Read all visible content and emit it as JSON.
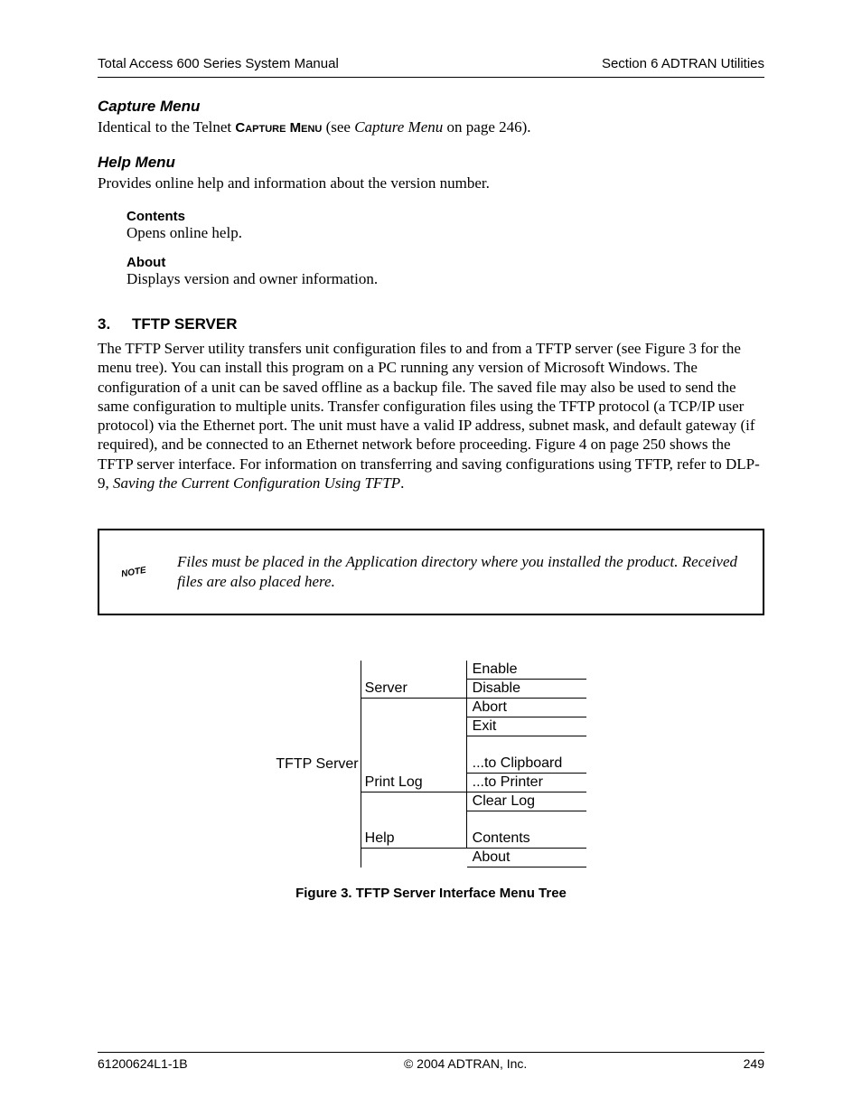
{
  "header": {
    "left": "Total Access 600 Series System Manual",
    "right": "Section 6  ADTRAN Utilities"
  },
  "capture": {
    "heading": "Capture Menu",
    "text_pre": "Identical to the Telnet ",
    "text_sc": "Capture Menu",
    "text_mid": " (see ",
    "text_ref": "Capture Menu",
    "text_post": " on page 246)."
  },
  "help": {
    "heading": "Help Menu",
    "text": "Provides online help and information about the version number.",
    "items": [
      {
        "label": "Contents",
        "desc": "Opens online help."
      },
      {
        "label": "About",
        "desc": "Displays version and owner information."
      }
    ]
  },
  "section": {
    "num": "3.",
    "title": "TFTP SERVER",
    "body": "The TFTP Server utility transfers unit configuration files to and from a TFTP server (see Figure 3 for the menu tree). You can install this program on a PC running any version of Microsoft Windows. The configuration of a unit can be saved offline as a backup file. The saved file may also be used to send the same configuration to multiple units. Transfer configuration files using the TFTP protocol (a TCP/IP user protocol) via the Ethernet port. The unit must have a valid IP address, subnet mask, and default gateway (if required), and be connected to an Ethernet network before proceeding. Figure 4 on page 250 shows the TFTP server interface. For information on transferring and saving configurations using TFTP, refer to DLP-9, ",
    "body_ref": "Saving the Current Configuration Using TFTP",
    "body_post": "."
  },
  "note": "Files must be placed in the Application directory where you installed the product. Received files are also placed here.",
  "tree": {
    "root": "TFTP Server",
    "groups": [
      {
        "label": "Server",
        "children": [
          "Enable",
          "Disable",
          "Abort",
          "Exit"
        ]
      },
      {
        "label": "Print Log",
        "children": [
          "...to Clipboard",
          "...to Printer",
          "Clear Log"
        ]
      },
      {
        "label": "Help",
        "children": [
          "Contents",
          "About"
        ]
      }
    ]
  },
  "figure_caption": "Figure 3.  TFTP Server Interface Menu Tree",
  "footer": {
    "left": "61200624L1-1B",
    "center": "© 2004 ADTRAN, Inc.",
    "right": "249"
  }
}
